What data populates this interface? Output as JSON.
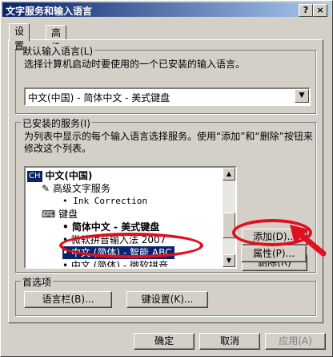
{
  "window": {
    "title": "文字服务和输入语言",
    "help_btn": "?",
    "close_btn": "×"
  },
  "tabs": [
    {
      "label": "设置"
    },
    {
      "label": "高级"
    }
  ],
  "default_lang": {
    "legend": "默认输入语言(L)",
    "desc": "选择计算机启动时要使用的一个已安装的输入语言。",
    "selected": "中文(中国) - 简体中文 - 美式键盘"
  },
  "installed": {
    "legend": "已安装的服务(I)",
    "desc": "为列表中显示的每个输入语言选择服务。使用“添加”和“删除”按钮来修改这个列表。",
    "tree": [
      {
        "badge": "CH",
        "label": "中文(中国)"
      },
      {
        "label": "高级文字服务"
      },
      {
        "bullet": "•",
        "label": "Ink Correction"
      },
      {
        "label": "键盘"
      },
      {
        "bullet": "•",
        "label": "简体中文 - 美式键盘"
      },
      {
        "bullet": "•",
        "label": "微软拼音输入法 2007"
      },
      {
        "bullet": "•",
        "label": "中文 (简体) - 智能 ABC"
      },
      {
        "bullet": "•",
        "label": "中文 (简体) - 微软拼音"
      }
    ],
    "buttons": {
      "add": "添加(D)...",
      "remove": "删除(R)",
      "props": "属性(P)..."
    }
  },
  "prefs": {
    "legend": "首选项",
    "langbar": "语言栏(B)...",
    "keysettings": "键设置(K)..."
  },
  "footer": {
    "ok": "确定",
    "cancel": "取消",
    "apply": "应用(A)"
  },
  "colors": {
    "selection": "#0a246a",
    "annotation": "#e0101e"
  }
}
